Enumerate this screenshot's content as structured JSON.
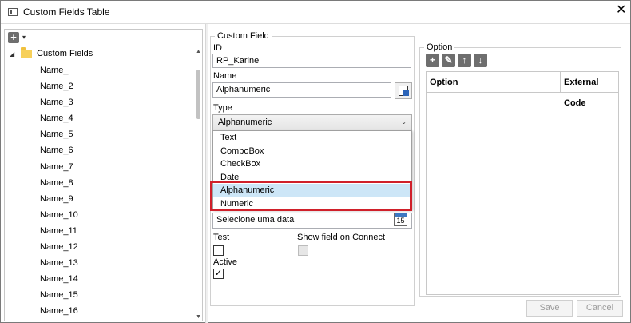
{
  "window": {
    "title": "Custom Fields Table",
    "close_glyph": "✕"
  },
  "tree": {
    "add_glyph": "+",
    "caret_glyph": "▾",
    "root_expander": "◢",
    "root_label": "Custom Fields",
    "items": [
      "Name_",
      "Name_2",
      "Name_3",
      "Name_4",
      "Name_5",
      "Name_6",
      "Name_7",
      "Name_8",
      "Name_9",
      "Name_10",
      "Name_11",
      "Name_12",
      "Name_13",
      "Name_14",
      "Name_15",
      "Name_16"
    ],
    "scroll_up": "▲",
    "scroll_down": "▼"
  },
  "custom_field": {
    "legend": "Custom Field",
    "id_label": "ID",
    "id_value": "RP_Karine",
    "name_label": "Name",
    "name_value": "Alphanumeric",
    "type_label": "Type",
    "type_value": "Alphanumeric",
    "type_chevron": "⌄",
    "type_options": [
      "Text",
      "ComboBox",
      "CheckBox",
      "Date",
      "Alphanumeric",
      "Numeric"
    ],
    "type_selected_index": 4,
    "date_placeholder": "Selecione uma data",
    "calendar_day": "15",
    "test_label": "Test",
    "show_field_label": "Show field on Connect",
    "active_label": "Active",
    "test_checked": false,
    "show_field_checked": false,
    "active_checked": true,
    "check_glyph": "✓"
  },
  "option": {
    "legend": "Option",
    "toolbar": {
      "add": "+",
      "edit": "✎",
      "up": "↑",
      "down": "↓"
    },
    "columns": [
      "Option",
      "External Code"
    ]
  },
  "footer": {
    "save_label": "Save",
    "cancel_label": "Cancel"
  },
  "colors": {
    "highlight": "#d0202a",
    "selection": "#cde6f7"
  }
}
